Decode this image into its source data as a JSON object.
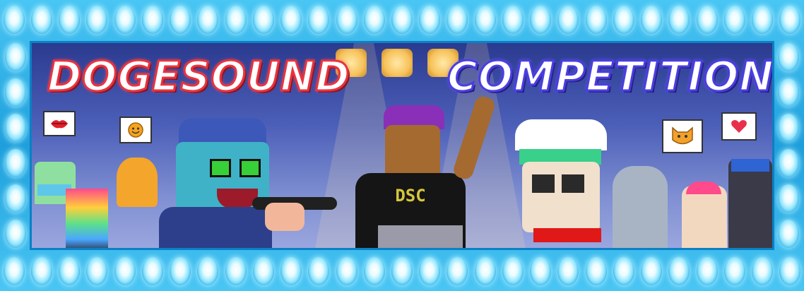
{
  "banner": {
    "title_left": "DOGESOUND",
    "title_right": "COMPETITION",
    "dj_shirt_text": "DSC"
  },
  "icons": {
    "lips": "lips-icon",
    "smiley": "smiley-icon",
    "doge": "doge-face-icon",
    "heart": "heart-icon"
  },
  "colors": {
    "title_left_outline": "#e8343f",
    "title_right_outline": "#4a3ee0",
    "frame_bulbs": "#8fe6ff",
    "stage_bg": "#4c5fb8"
  }
}
